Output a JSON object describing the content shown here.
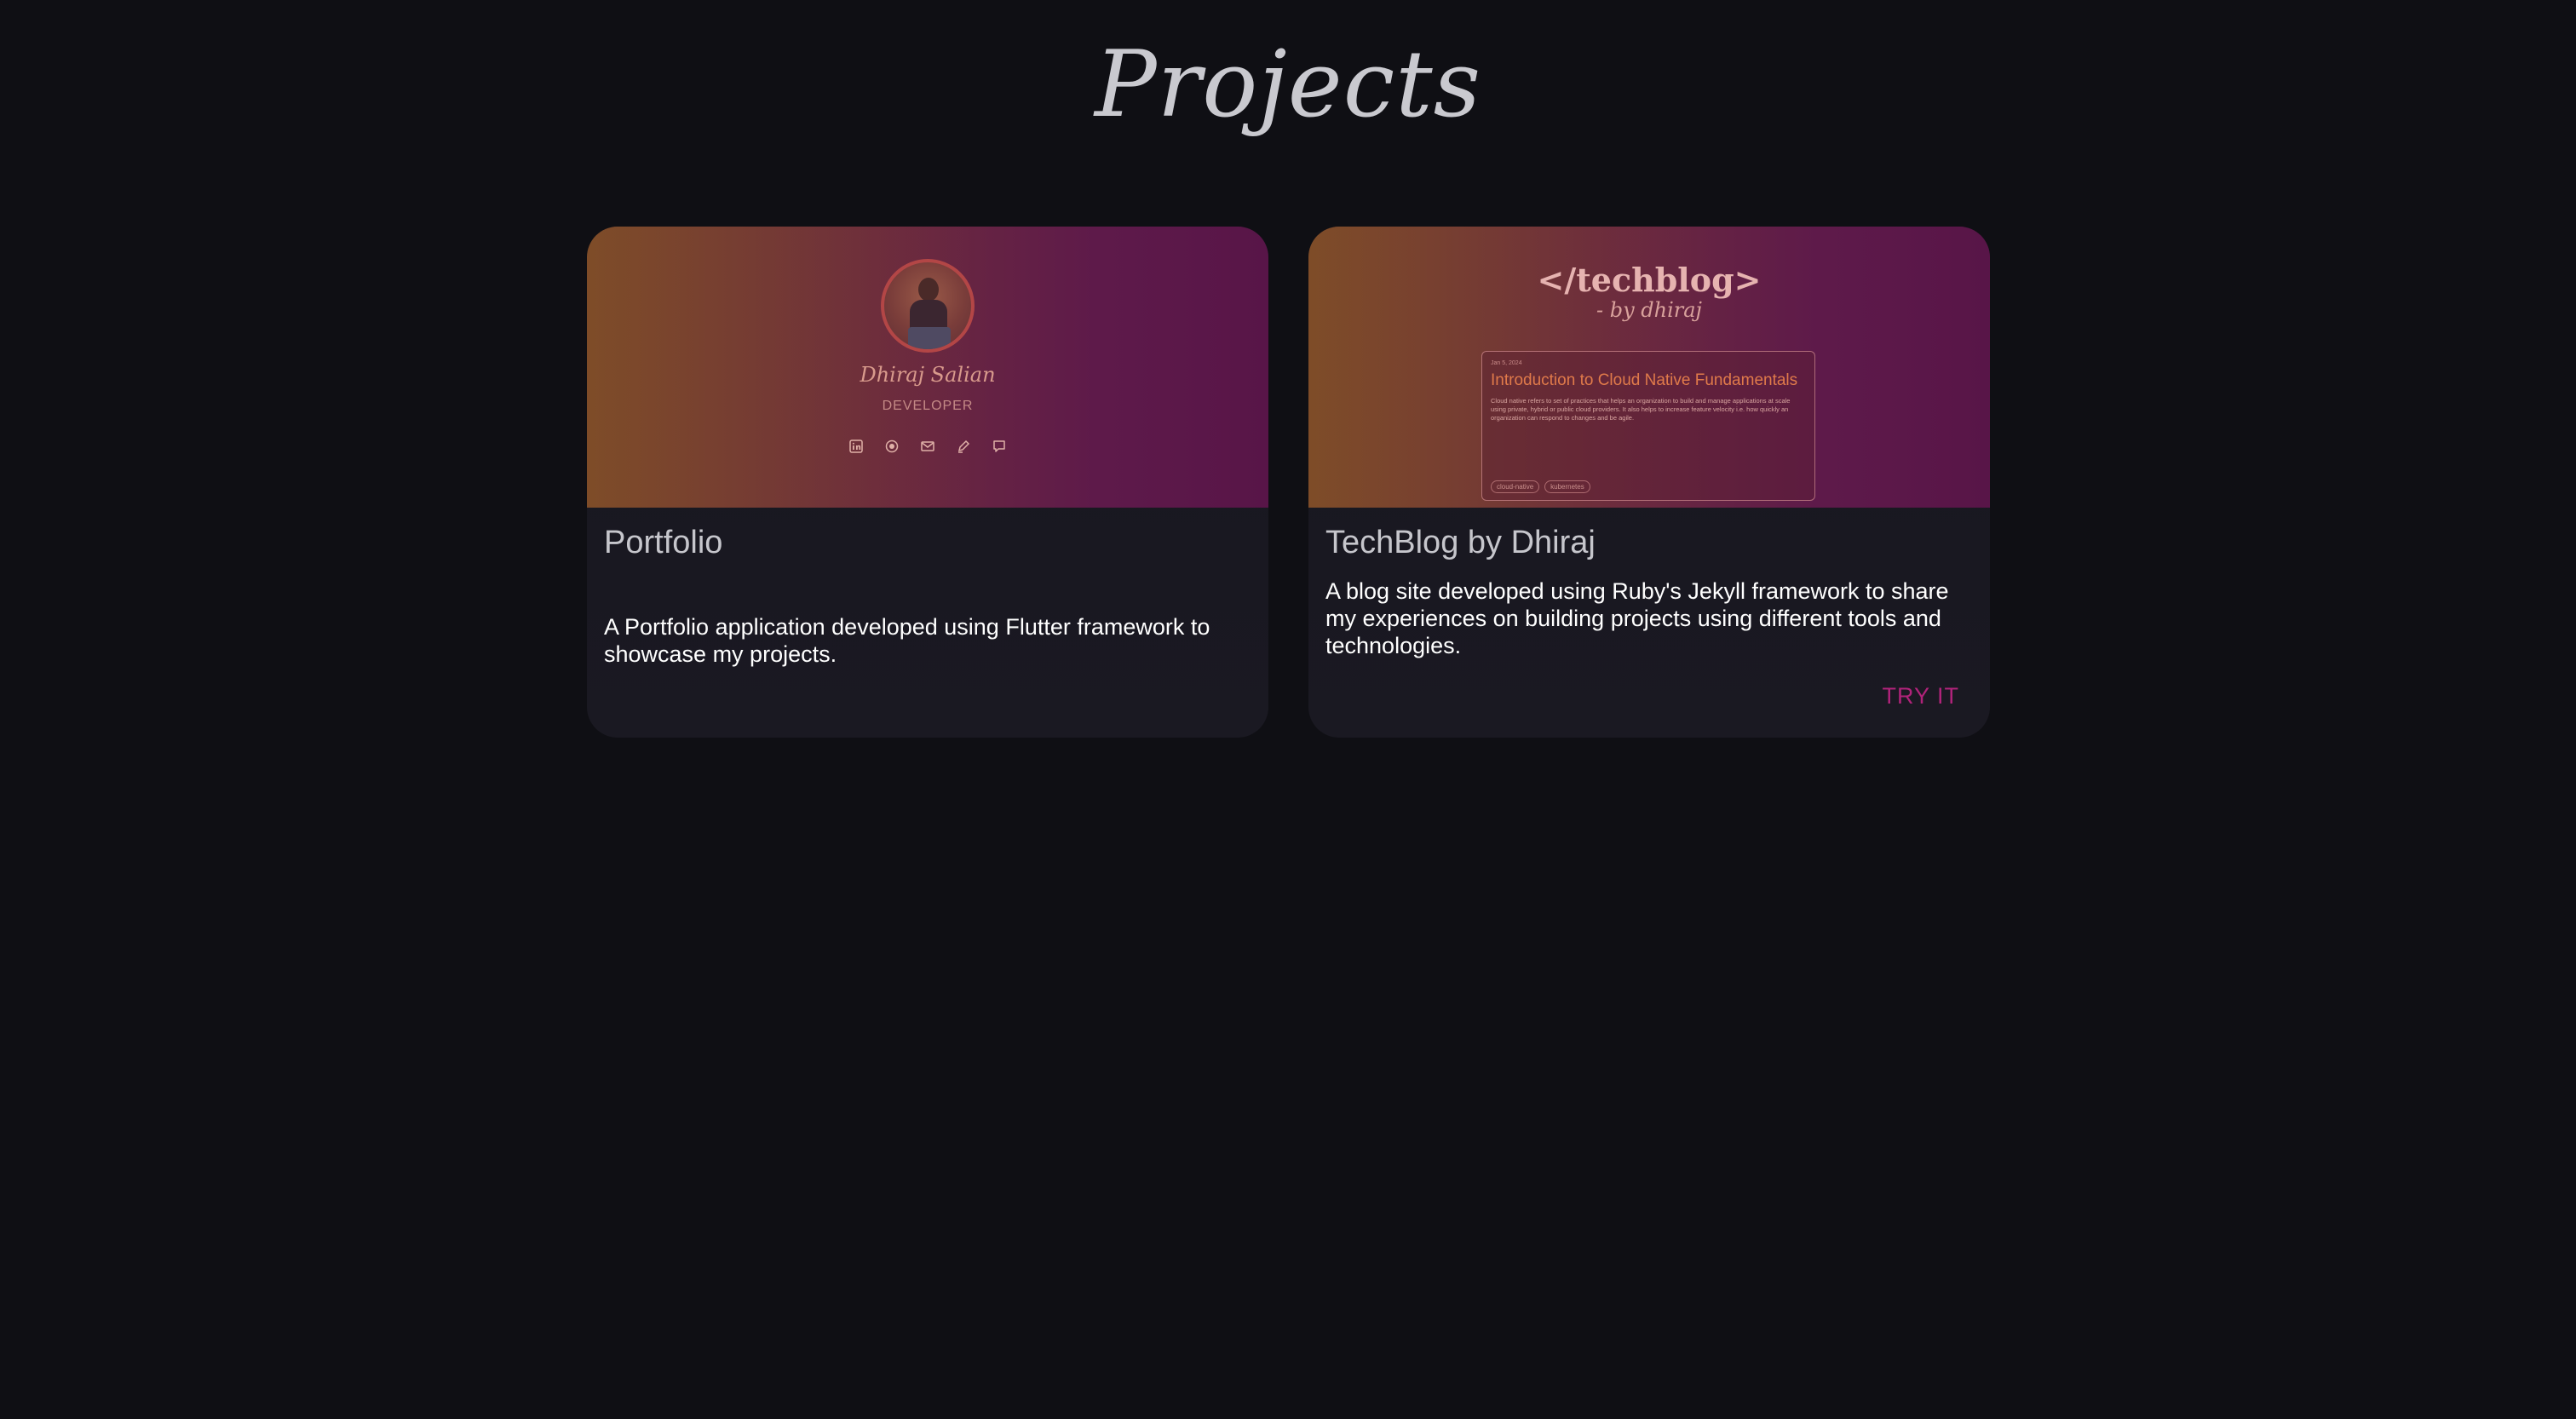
{
  "page": {
    "title": "Projects"
  },
  "projects": [
    {
      "title": "Portfolio",
      "description": "A Portfolio application developed using Flutter framework to showcase my projects.",
      "preview": {
        "name": "Dhiraj Salian",
        "role": "DEVELOPER",
        "icons": [
          "linkedin-icon",
          "github-icon",
          "mail-icon",
          "edit-icon",
          "chat-icon"
        ]
      }
    },
    {
      "title": "TechBlog by Dhiraj",
      "description": "A blog site developed using Ruby's Jekyll framework to share my experiences on building projects using different tools and technologies.",
      "action_label": "TRY IT",
      "preview": {
        "logo": "</techblog>",
        "byline": "- by dhiraj",
        "post_date": "Jan 5, 2024",
        "post_title": "Introduction to Cloud Native Fundamentals",
        "post_excerpt": "Cloud native refers to set of practices that helps an organization to build and manage applications at scale using private, hybrid or public cloud providers. It also helps to increase feature velocity i.e. how quickly an organization can respond to changes and be agile.",
        "tags": [
          "cloud-native",
          "kubernetes"
        ]
      }
    }
  ],
  "colors": {
    "background": "#0f0f14",
    "card_background": "#17161f",
    "accent": "#b0237a",
    "banner_gradient_start": "#7a4a28",
    "banner_gradient_end": "#581548"
  }
}
